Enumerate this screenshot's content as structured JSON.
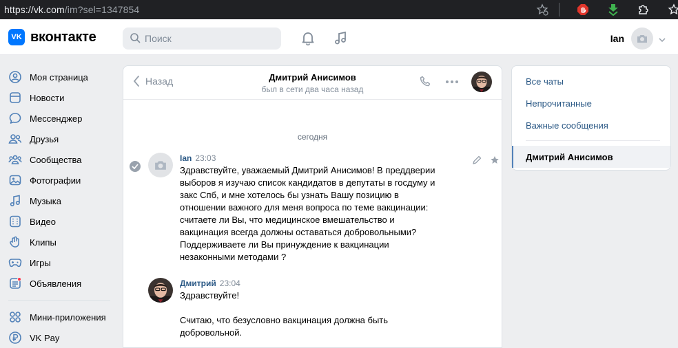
{
  "browser": {
    "url_host": "https://vk.com",
    "url_path": "/im?sel=1347854"
  },
  "header": {
    "logo_text": "вконтакте",
    "logo_mark": "VK",
    "search_placeholder": "Поиск",
    "user_name": "Ian"
  },
  "sidebar": {
    "items": [
      {
        "label": "Моя страница",
        "icon": "user-circle-icon"
      },
      {
        "label": "Новости",
        "icon": "newsfeed-icon"
      },
      {
        "label": "Мессенджер",
        "icon": "message-icon"
      },
      {
        "label": "Друзья",
        "icon": "friends-icon"
      },
      {
        "label": "Сообщества",
        "icon": "communities-icon"
      },
      {
        "label": "Фотографии",
        "icon": "photo-icon"
      },
      {
        "label": "Музыка",
        "icon": "music-icon"
      },
      {
        "label": "Видео",
        "icon": "video-icon"
      },
      {
        "label": "Клипы",
        "icon": "clips-icon"
      },
      {
        "label": "Игры",
        "icon": "gamepad-icon"
      },
      {
        "label": "Объявления",
        "icon": "classifieds-icon"
      },
      {
        "label": "Мини-приложения",
        "icon": "apps-icon"
      },
      {
        "label": "VK Pay",
        "icon": "vkpay-icon"
      }
    ]
  },
  "chat": {
    "back_label": "Назад",
    "peer_name": "Дмитрий Анисимов",
    "peer_status": "был в сети два часа назад",
    "date_separator": "сегодня",
    "messages": [
      {
        "author": "Ian",
        "time": "23:03",
        "lines": [
          "Здравствуйте, уважаемый Дмитрий Анисимов! В преддверии",
          "выборов я изучаю список кандидатов в депутаты в госдуму и",
          "закс Спб, и мне хотелось бы узнать Вашу позицию в",
          "отношении важного для меня вопроса по теме вакцинации:",
          "считаете ли Вы, что медицинское вмешательство и",
          "вакцинация всегда должны оставаться добровольными?",
          "Поддерживаете ли Вы принуждение к вакцинации",
          "незаконными методами ?"
        ]
      },
      {
        "author": "Дмитрий",
        "time": "23:04",
        "lines": [
          "Здравствуйте!",
          "",
          "Считаю, что безусловно вакцинация должна быть",
          "добровольной."
        ]
      }
    ]
  },
  "right_panel": {
    "items": [
      "Все чаты",
      "Непрочитанные",
      "Важные сообщения"
    ],
    "active_chat": "Дмитрий Анисимов"
  },
  "colors": {
    "vk_blue": "#0077ff",
    "link_blue": "#2a5885",
    "page_bg": "#edeef0",
    "notification_red": "#ff3347"
  }
}
